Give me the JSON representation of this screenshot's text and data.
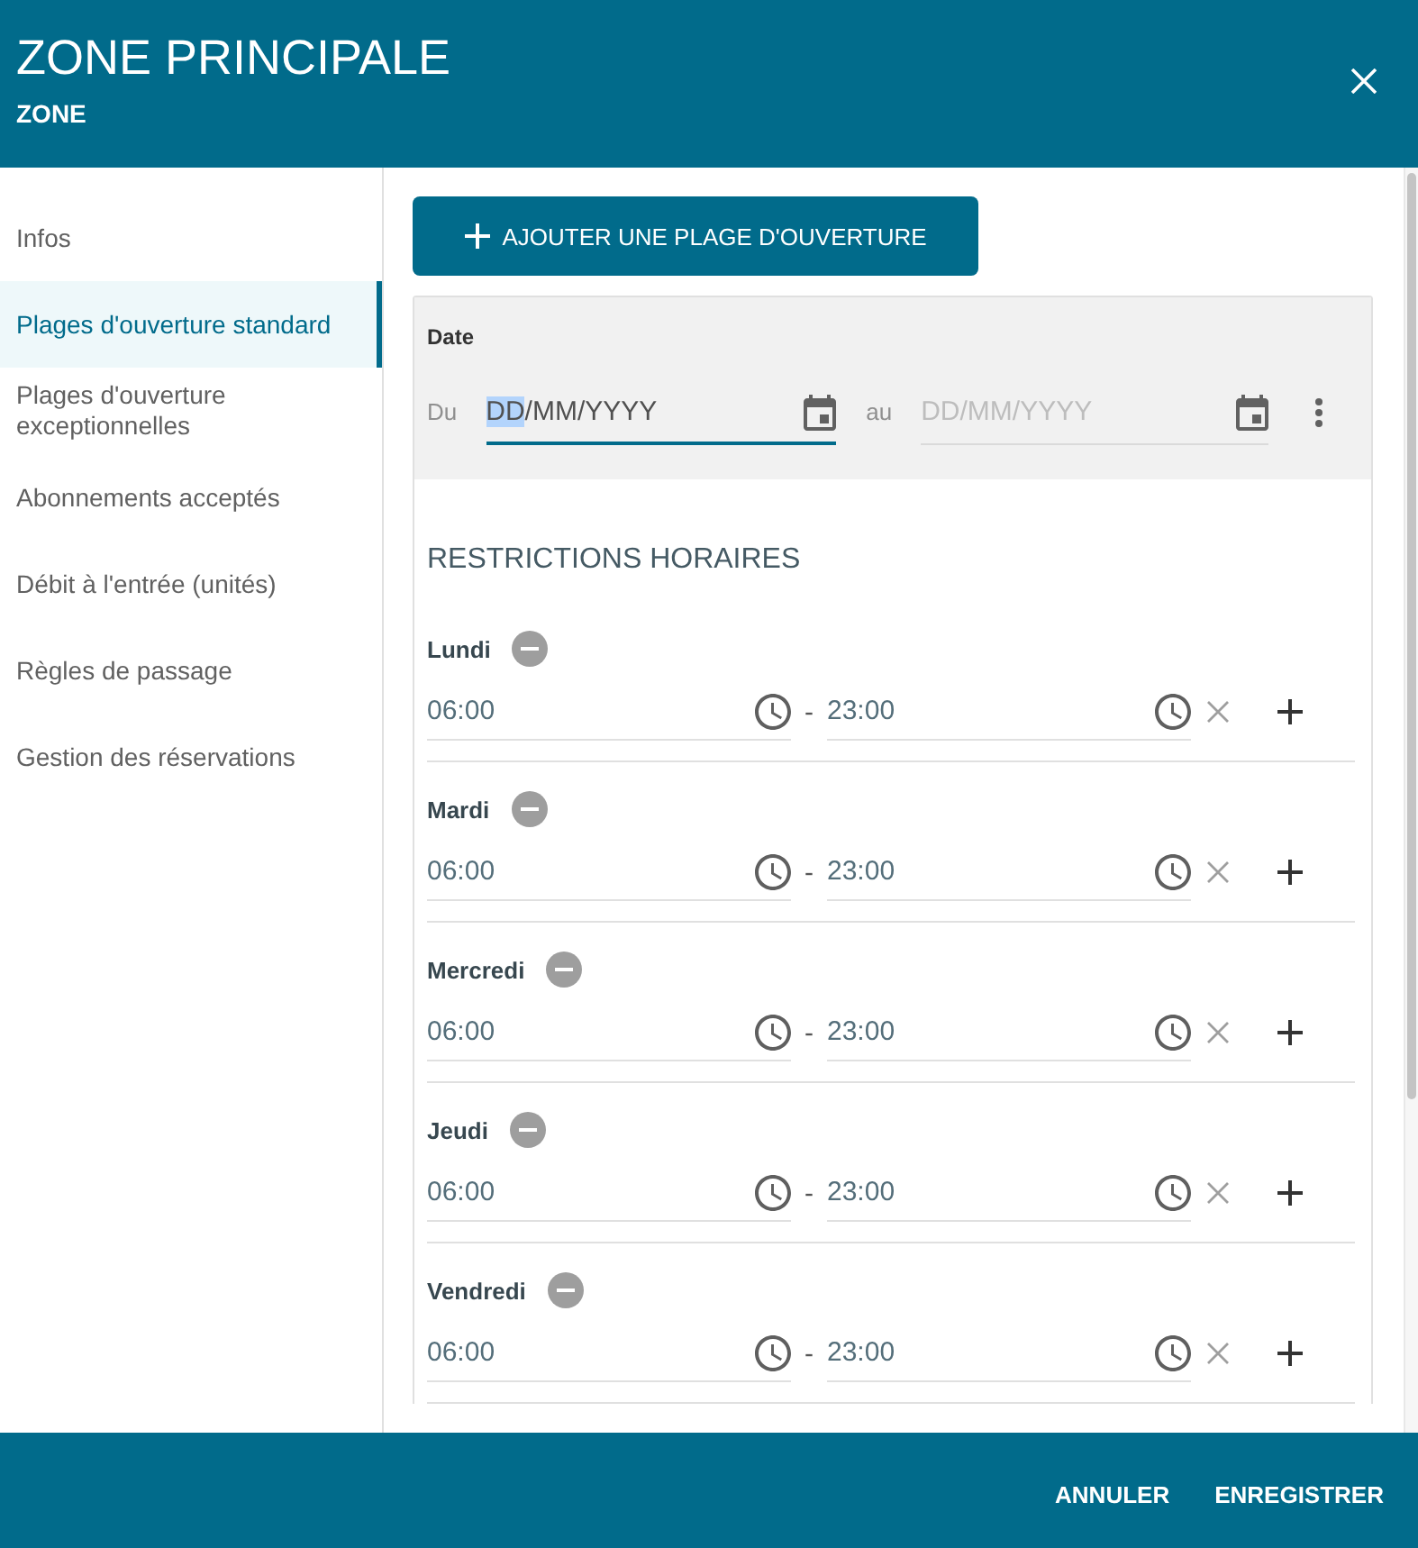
{
  "header": {
    "title": "ZONE PRINCIPALE",
    "subtitle": "ZONE"
  },
  "sidebar": {
    "items": [
      {
        "label": "Infos",
        "selected": false
      },
      {
        "label": "Plages d'ouverture standard",
        "selected": true
      },
      {
        "label": "Plages d'ouverture exceptionnelles",
        "selected": false
      },
      {
        "label": "Abonnements acceptés",
        "selected": false
      },
      {
        "label": "Débit à l'entrée (unités)",
        "selected": false
      },
      {
        "label": "Règles de passage",
        "selected": false
      },
      {
        "label": "Gestion des réservations",
        "selected": false
      }
    ]
  },
  "add_button": {
    "label": "AJOUTER UNE PLAGE D'OUVERTURE"
  },
  "date_filter": {
    "label": "Date",
    "fields": [
      {
        "label": "Du",
        "focused": true,
        "value_parts": [
          {
            "text": "DD",
            "selected": true
          },
          {
            "text": "/MM/YYYY",
            "selected": false
          }
        ]
      },
      {
        "label": "au",
        "focused": false,
        "placeholder": "DD/MM/YYYY"
      }
    ]
  },
  "restrictions": {
    "title": "RESTRICTIONS HORAIRES",
    "days": [
      {
        "name": "Lundi",
        "slots": [
          {
            "start": "06:00",
            "separator": "-",
            "end": "23:00"
          }
        ]
      },
      {
        "name": "Mardi",
        "slots": [
          {
            "start": "06:00",
            "separator": "-",
            "end": "23:00"
          }
        ]
      },
      {
        "name": "Mercredi",
        "slots": [
          {
            "start": "06:00",
            "separator": "-",
            "end": "23:00"
          }
        ]
      },
      {
        "name": "Jeudi",
        "slots": [
          {
            "start": "06:00",
            "separator": "-",
            "end": "23:00"
          }
        ]
      },
      {
        "name": "Vendredi",
        "slots": [
          {
            "start": "06:00",
            "separator": "-",
            "end": "23:00"
          }
        ]
      }
    ]
  },
  "footer": {
    "buttons": [
      {
        "label": "ANNULER"
      },
      {
        "label": "ENREGISTRER"
      }
    ]
  }
}
